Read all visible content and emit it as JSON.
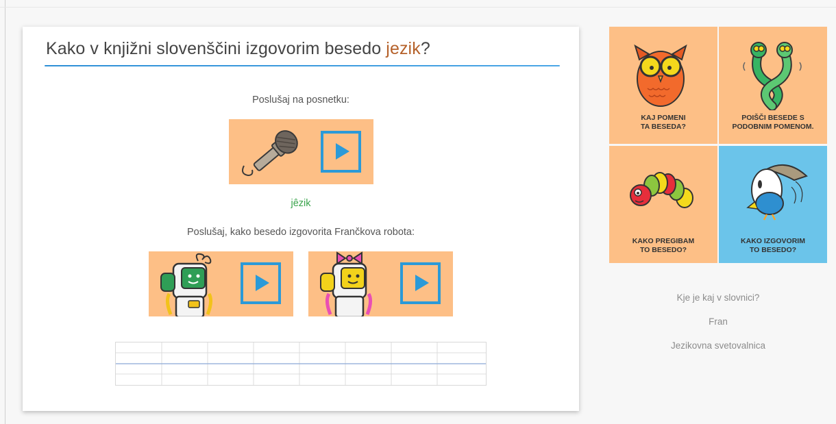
{
  "page": {
    "title_prefix": "Kako v knjižni slovenščini izgovorim besedo ",
    "title_word": "jezik",
    "title_suffix": "?",
    "listen_label": "Poslušaj na posnetku:",
    "word_accent_char": "ê",
    "word_before": "j",
    "word_after": "zik",
    "robots_label": "Poslušaj, kako besedo izgovorita Frančkova robota:"
  },
  "tiles": [
    {
      "line1": "KAJ POMENI",
      "line2": "TA BESEDA?"
    },
    {
      "line1": "POIŠČI BESEDE S",
      "line2": "PODOBNIM POMENOM."
    },
    {
      "line1": "KAKO PREGIBAM",
      "line2": "TO BESEDO?"
    },
    {
      "line1": "KAKO IZGOVORIM",
      "line2": "TO BESEDO?"
    }
  ],
  "links": {
    "where": "Kje je kaj v slovnici?",
    "fran": "Fran",
    "jezikovna": "Jezikovna svetovalnica"
  },
  "colors": {
    "tile_orange": "#fdbf86",
    "tile_active": "#6bc4ea",
    "play_blue": "#2b9ad8",
    "title_accent": "#b5612a",
    "word_green": "#3aa34c"
  },
  "icons": [
    "microphone-icon",
    "play-icon",
    "owl-icon",
    "snakes-icon",
    "caterpillar-icon",
    "bird-icon",
    "green-robot-icon",
    "yellow-robot-icon"
  ]
}
